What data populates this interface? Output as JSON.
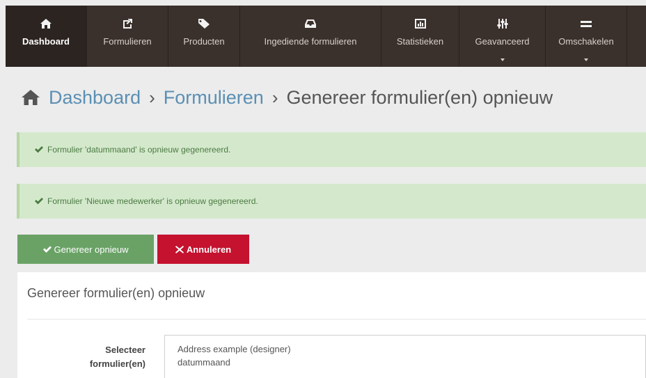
{
  "nav": {
    "items": [
      {
        "label": "Dashboard",
        "icon": "home-icon",
        "active": true
      },
      {
        "label": "Formulieren",
        "icon": "forms-icon"
      },
      {
        "label": "Producten",
        "icon": "tag-icon"
      },
      {
        "label": "Ingediende formulieren",
        "icon": "inbox-icon"
      },
      {
        "label": "Statistieken",
        "icon": "bar-chart-icon"
      },
      {
        "label": "Geavanceerd",
        "icon": "sliders-icon",
        "dropdown": true
      },
      {
        "label": "Omschakelen",
        "icon": "menu-icon",
        "dropdown": true
      }
    ]
  },
  "breadcrumb": {
    "home": "Dashboard",
    "section": "Formulieren",
    "current": "Genereer formulier(en) opnieuw"
  },
  "alerts": [
    {
      "text": "Formulier 'datummaand' is opnieuw gegenereerd."
    },
    {
      "text": "Formulier 'Nieuwe medewerker' is opnieuw gegenereerd."
    }
  ],
  "actions": {
    "regenerate_label": "Genereer opnieuw",
    "cancel_label": "Annuleren"
  },
  "panel": {
    "title": "Genereer formulier(en) opnieuw",
    "field_label_line1": "Selecteer",
    "field_label_line2": "formulier(en)",
    "options": [
      "Address example (designer)",
      "datummaand"
    ]
  },
  "colors": {
    "nav_bg": "#3a302c",
    "link": "#5b8fb3",
    "alert_bg": "#d4e9cc",
    "success_btn": "#6aa266",
    "danger_btn": "#c4122f"
  }
}
